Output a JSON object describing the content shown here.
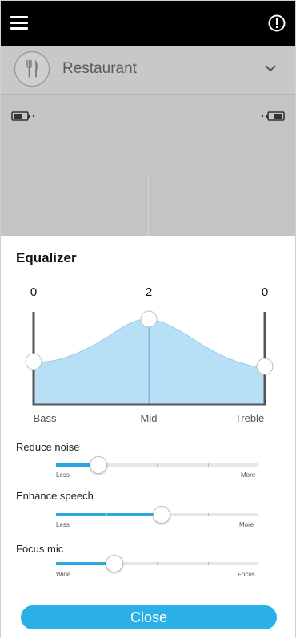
{
  "header": {
    "menu_icon": "hamburger-menu-icon",
    "alert_icon": "exclamation-circle-icon"
  },
  "program": {
    "icon": "fork-knife-icon",
    "name": "Restaurant",
    "chevron_icon": "chevron-down-icon"
  },
  "devices": {
    "left_icon": "left-battery-icon",
    "right_icon": "right-battery-icon"
  },
  "equalizer": {
    "title": "Equalizer",
    "bands": [
      {
        "name": "Bass",
        "value": "0"
      },
      {
        "name": "Mid",
        "value": "2"
      },
      {
        "name": "Treble",
        "value": "0"
      }
    ],
    "fill_color": "#b7e0f7"
  },
  "sliders": [
    {
      "label": "Reduce noise",
      "min_label": "Less",
      "max_label": "More",
      "level": 0.21
    },
    {
      "label": "Enhance speech",
      "min_label": "Less",
      "max_label": "More",
      "level": 0.52
    },
    {
      "label": "Focus mic",
      "min_label": "Wide",
      "max_label": "Focus",
      "level": 0.29
    }
  ],
  "accent_color": "#2aa7df",
  "close_label": "Close"
}
